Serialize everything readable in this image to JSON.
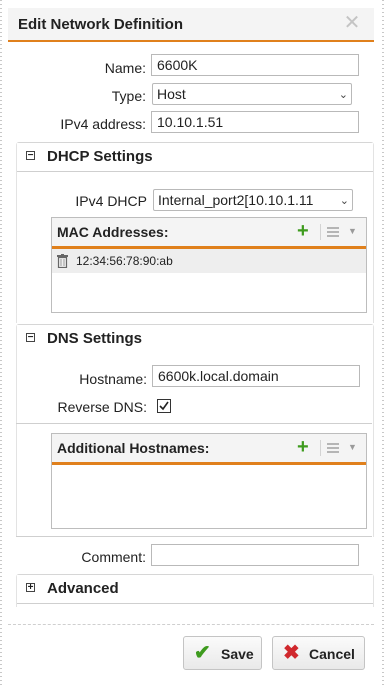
{
  "dialog": {
    "title": "Edit Network Definition",
    "close_icon": "close-icon"
  },
  "fields": {
    "name_label": "Name:",
    "name_value": "6600K",
    "type_label": "Type:",
    "type_value": "Host",
    "ipv4_label": "IPv4 address:",
    "ipv4_value": "10.10.1.51"
  },
  "dhcp": {
    "title": "DHCP Settings",
    "ipv4_dhcp_label": "IPv4 DHCP",
    "ipv4_dhcp_value": "Internal_port2[10.10.1.11",
    "mac_title": "MAC Addresses:",
    "mac_rows": [
      "12:34:56:78:90:ab"
    ]
  },
  "dns": {
    "title": "DNS Settings",
    "hostname_label": "Hostname:",
    "hostname_value": "6600k.local.domain",
    "reverse_dns_label": "Reverse DNS:",
    "reverse_dns_checked": true,
    "additional_title": "Additional Hostnames:"
  },
  "comment": {
    "label": "Comment:",
    "value": ""
  },
  "advanced": {
    "title": "Advanced"
  },
  "buttons": {
    "save": "Save",
    "cancel": "Cancel"
  },
  "colors": {
    "accent": "#e0801c",
    "save_icon": "#3e9b1e",
    "cancel_icon": "#d0282d"
  }
}
